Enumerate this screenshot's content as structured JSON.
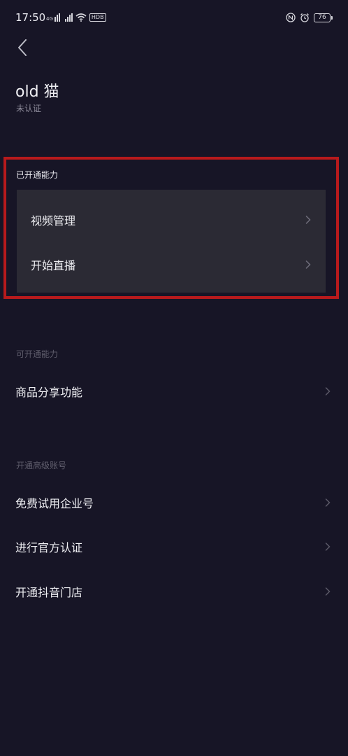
{
  "status_bar": {
    "time": "17:50",
    "signal_label": "4G",
    "hd_label": "HDB",
    "battery": "76"
  },
  "header": {
    "account_name": "old 猫",
    "verification_status": "未认证"
  },
  "sections": {
    "enabled": {
      "title": "已开通能力",
      "items": [
        {
          "label": "视频管理"
        },
        {
          "label": "开始直播"
        }
      ]
    },
    "available": {
      "title": "可开通能力",
      "items": [
        {
          "label": "商品分享功能"
        }
      ]
    },
    "advanced": {
      "title": "开通高级账号",
      "items": [
        {
          "label": "免费试用企业号"
        },
        {
          "label": "进行官方认证"
        },
        {
          "label": "开通抖音门店"
        }
      ]
    }
  },
  "colors": {
    "background": "#171526",
    "panel": "#2b2a34",
    "highlight": "#b81a1c"
  },
  "icons": [
    "back-arrow-icon",
    "chevron-right-icon",
    "signal-icon",
    "wifi-icon",
    "nfc-icon",
    "alarm-icon",
    "battery-icon"
  ]
}
